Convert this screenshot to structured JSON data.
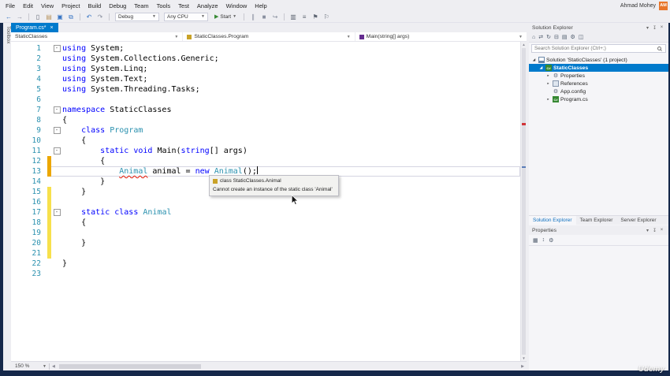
{
  "app": {
    "user_name": "Ahmad Mohey",
    "avatar_initials": "AM",
    "watermark": "Udemy"
  },
  "colors": {
    "accent": "#007acc",
    "keyword": "#0000ff",
    "type_name": "#2b91af",
    "error_squiggle": "#e51400",
    "changed_line_yellow": "#f7e04c",
    "changed_line_orange": "#eca700",
    "frame_navy": "#15284a"
  },
  "menu_bar": {
    "items": [
      "File",
      "Edit",
      "View",
      "Project",
      "Build",
      "Debug",
      "Team",
      "Tools",
      "Test",
      "Analyze",
      "Window",
      "Help"
    ]
  },
  "toolbar": {
    "items": [
      {
        "t": "icon",
        "n": "back",
        "g": "←",
        "c": "#3a76c4"
      },
      {
        "t": "icon",
        "n": "forward",
        "g": "→",
        "c": "#8a90a0"
      },
      {
        "t": "sep"
      },
      {
        "t": "icon",
        "n": "new-file",
        "g": "▯",
        "c": "#5f6673"
      },
      {
        "t": "icon",
        "n": "open-file",
        "g": "▤",
        "c": "#b99662"
      },
      {
        "t": "icon",
        "n": "save",
        "g": "▣",
        "c": "#3a76c4"
      },
      {
        "t": "icon",
        "n": "save-all",
        "g": "⧉",
        "c": "#3a76c4"
      },
      {
        "t": "sep"
      },
      {
        "t": "icon",
        "n": "undo",
        "g": "↶",
        "c": "#3a76c4"
      },
      {
        "t": "icon",
        "n": "redo",
        "g": "↷",
        "c": "#8a90a0"
      },
      {
        "t": "sep"
      },
      {
        "t": "dd",
        "n": "solution-configuration",
        "label": "Debug"
      },
      {
        "t": "dd",
        "n": "solution-platform",
        "label": "Any CPU"
      },
      {
        "t": "start",
        "n": "start-debugging",
        "label": "Start"
      },
      {
        "t": "sep"
      },
      {
        "t": "icon",
        "n": "break-all",
        "g": "∥",
        "c": "#8a90a0"
      },
      {
        "t": "icon",
        "n": "stop-debugging",
        "g": "■",
        "c": "#8a90a0"
      },
      {
        "t": "icon",
        "n": "step-over",
        "g": "↪",
        "c": "#8a90a0"
      },
      {
        "t": "sep"
      },
      {
        "t": "icon",
        "n": "find-in-files",
        "g": "▥",
        "c": "#5f6673"
      },
      {
        "t": "icon",
        "n": "comment-lines",
        "g": "≡",
        "c": "#5f6673"
      },
      {
        "t": "icon",
        "n": "bookmark",
        "g": "⚑",
        "c": "#5f6673"
      },
      {
        "t": "icon",
        "n": "bookmark-list",
        "g": "⚐",
        "c": "#5f6673"
      }
    ]
  },
  "left_rail": {
    "toolbox_label": "Toolbox"
  },
  "editor": {
    "tab_title": "Program.cs*",
    "breadcrumbs": [
      {
        "label": "StaticClasses",
        "icon": null
      },
      {
        "label": "StaticClasses.Program",
        "icon": "class"
      },
      {
        "label": "Main(string[] args)",
        "icon": "method"
      }
    ],
    "zoom_level": "150 %",
    "tooltip": {
      "signature": "class StaticClasses.Animal",
      "message": "Cannot create an instance of the static class 'Animal'"
    },
    "code": {
      "lines": [
        {
          "fold": true,
          "tokens": [
            [
              "k",
              "using"
            ],
            [
              "p",
              " System;"
            ]
          ]
        },
        {
          "tokens": [
            [
              "k",
              "using"
            ],
            [
              "p",
              " System.Collections.Generic;"
            ]
          ]
        },
        {
          "tokens": [
            [
              "k",
              "using"
            ],
            [
              "p",
              " System.Linq;"
            ]
          ]
        },
        {
          "tokens": [
            [
              "k",
              "using"
            ],
            [
              "p",
              " System.Text;"
            ]
          ]
        },
        {
          "tokens": [
            [
              "k",
              "using"
            ],
            [
              "p",
              " System.Threading.Tasks;"
            ]
          ]
        },
        {
          "tokens": []
        },
        {
          "fold": true,
          "tokens": [
            [
              "k",
              "namespace"
            ],
            [
              "p",
              " StaticClasses"
            ]
          ]
        },
        {
          "tokens": [
            [
              "p",
              "{"
            ]
          ]
        },
        {
          "fold": true,
          "tokens": [
            [
              "p",
              "    "
            ],
            [
              "k",
              "class"
            ],
            [
              "p",
              " "
            ],
            [
              "c",
              "Program"
            ]
          ]
        },
        {
          "tokens": [
            [
              "p",
              "    {"
            ]
          ]
        },
        {
          "fold": true,
          "tokens": [
            [
              "p",
              "        "
            ],
            [
              "k",
              "static"
            ],
            [
              "p",
              " "
            ],
            [
              "k",
              "void"
            ],
            [
              "p",
              " Main("
            ],
            [
              "k",
              "string"
            ],
            [
              "p",
              "[] args)"
            ]
          ]
        },
        {
          "chg": "o",
          "tokens": [
            [
              "p",
              "        {"
            ]
          ]
        },
        {
          "chg": "o",
          "cur": true,
          "caret": true,
          "tokens": [
            [
              "p",
              "            "
            ],
            [
              "ce",
              "Animal"
            ],
            [
              "p",
              " animal = "
            ],
            [
              "k",
              "new"
            ],
            [
              "p",
              " "
            ],
            [
              "ce",
              "Animal"
            ],
            [
              "p",
              "();"
            ]
          ]
        },
        {
          "tokens": [
            [
              "p",
              "        }"
            ]
          ]
        },
        {
          "chg": "y",
          "tokens": [
            [
              "p",
              "    }"
            ]
          ]
        },
        {
          "chg": "y",
          "tokens": []
        },
        {
          "chg": "y",
          "fold": true,
          "tokens": [
            [
              "p",
              "    "
            ],
            [
              "k",
              "static"
            ],
            [
              "p",
              " "
            ],
            [
              "k",
              "class"
            ],
            [
              "p",
              " "
            ],
            [
              "c",
              "Animal"
            ]
          ]
        },
        {
          "chg": "y",
          "tokens": [
            [
              "p",
              "    {"
            ]
          ]
        },
        {
          "chg": "y",
          "tokens": []
        },
        {
          "chg": "y",
          "tokens": [
            [
              "p",
              "    }"
            ]
          ]
        },
        {
          "chg": "y",
          "tokens": []
        },
        {
          "tokens": [
            [
              "p",
              "}"
            ]
          ]
        },
        {
          "tokens": []
        }
      ]
    }
  },
  "solution_explorer": {
    "title": "Solution Explorer",
    "header_icons": [
      {
        "n": "window-menu",
        "g": "▾"
      },
      {
        "n": "pin",
        "g": "↧"
      },
      {
        "n": "close",
        "g": "×"
      }
    ],
    "toolbar_icons": [
      {
        "n": "home",
        "g": "⌂"
      },
      {
        "n": "sync-active-document",
        "g": "⇄"
      },
      {
        "n": "refresh",
        "g": "↻"
      },
      {
        "n": "collapse-all",
        "g": "⊟"
      },
      {
        "n": "show-all-files",
        "g": "▤"
      },
      {
        "n": "properties",
        "g": "⚙"
      },
      {
        "n": "preview-selection",
        "g": "◫"
      }
    ],
    "search_placeholder": "Search Solution Explorer (Ctrl+;)",
    "tree": [
      {
        "label": "Solution 'StaticClasses' (1 project)",
        "level": 0,
        "icon": "solution",
        "expand": "open"
      },
      {
        "label": "StaticClasses",
        "level": 1,
        "icon": "csproj",
        "expand": "open",
        "selected": true
      },
      {
        "label": "Properties",
        "level": 2,
        "icon": "properties",
        "expand": "closed"
      },
      {
        "label": "References",
        "level": 2,
        "icon": "references",
        "expand": "closed"
      },
      {
        "label": "App.config",
        "level": 2,
        "icon": "config"
      },
      {
        "label": "Program.cs",
        "level": 2,
        "icon": "cs-file",
        "expand": "closed"
      }
    ],
    "bottom_tabs": [
      "Solution Explorer",
      "Team Explorer",
      "Server Explorer"
    ]
  },
  "properties_panel": {
    "title": "Properties",
    "header_icons": [
      {
        "n": "window-menu",
        "g": "▾"
      },
      {
        "n": "pin",
        "g": "↧"
      },
      {
        "n": "close",
        "g": "×"
      }
    ],
    "toolbar_icons": [
      {
        "n": "categorized",
        "g": "▦"
      },
      {
        "n": "alphabetical",
        "g": "↕"
      },
      {
        "n": "property-pages",
        "g": "⚙"
      }
    ]
  }
}
